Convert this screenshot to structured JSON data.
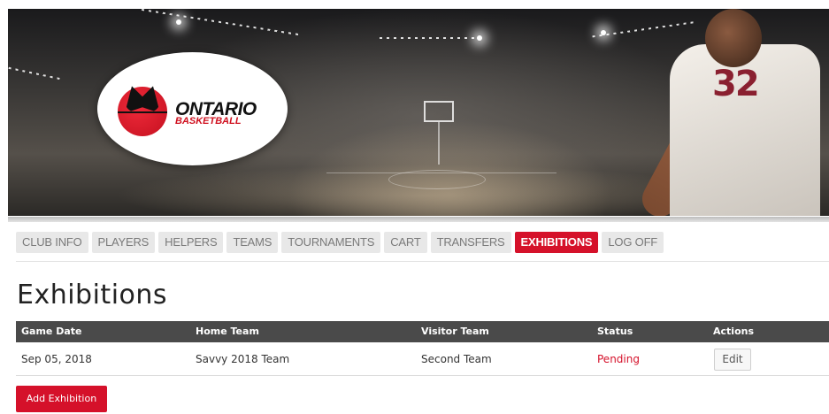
{
  "colors": {
    "accent": "#d5112a",
    "tab_bg": "#e8e8e8",
    "tab_text": "#7a7a7a",
    "table_header_bg": "#4a4a4a"
  },
  "banner": {
    "logo_word1": "ONTARIO",
    "logo_word2": "BASKETBALL",
    "jersey_number": "32"
  },
  "nav": {
    "tabs": [
      {
        "label": "CLUB INFO",
        "active": false
      },
      {
        "label": "PLAYERS",
        "active": false
      },
      {
        "label": "HELPERS",
        "active": false
      },
      {
        "label": "TEAMS",
        "active": false
      },
      {
        "label": "TOURNAMENTS",
        "active": false
      },
      {
        "label": "CART",
        "active": false
      },
      {
        "label": "TRANSFERS",
        "active": false
      },
      {
        "label": "EXHIBITIONS",
        "active": true
      },
      {
        "label": "LOG OFF",
        "active": false
      }
    ]
  },
  "page": {
    "title": "Exhibitions"
  },
  "table": {
    "headers": [
      "Game Date",
      "Home Team",
      "Visitor Team",
      "Status",
      "Actions"
    ],
    "rows": [
      {
        "game_date": "Sep 05, 2018",
        "home_team": "Savvy 2018 Team",
        "visitor_team": "Second Team",
        "status": "Pending",
        "action": "Edit"
      }
    ]
  },
  "buttons": {
    "add_exhibition": "Add Exhibition"
  }
}
